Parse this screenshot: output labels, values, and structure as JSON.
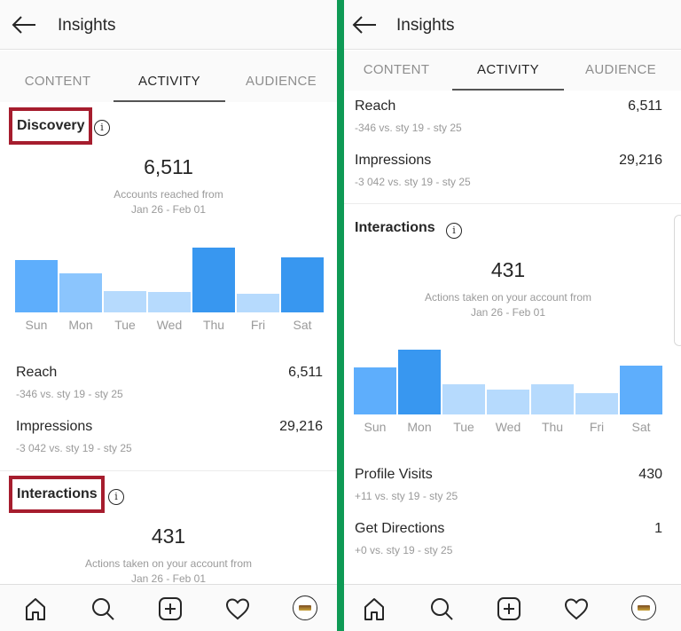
{
  "app": {
    "title": "Insights",
    "tabs": [
      "CONTENT",
      "ACTIVITY",
      "AUDIENCE"
    ],
    "active_tab": "ACTIVITY",
    "accent_colors": {
      "bar_dark": "#3897f0",
      "bar_mid": "#5eaefc",
      "bar_light_mid": "#8bc5fd",
      "bar_light": "#b6dafd",
      "highlight_box": "#a61d2e",
      "divider": "#0e9a55"
    }
  },
  "left": {
    "discovery": {
      "title": "Discovery",
      "value": "6,511",
      "caption_line1": "Accounts reached from",
      "caption_line2": "Jan 26 - Feb 01"
    },
    "metrics": [
      {
        "label": "Reach",
        "value": "6,511",
        "delta": "-346 vs. sty 19 - sty 25"
      },
      {
        "label": "Impressions",
        "value": "29,216",
        "delta": "-3 042 vs. sty 19 - sty 25"
      }
    ],
    "interactions": {
      "title": "Interactions",
      "value": "431",
      "caption_line1": "Actions taken on your account from",
      "caption_line2": "Jan 26 - Feb 01"
    }
  },
  "right": {
    "metrics_top": [
      {
        "label": "Reach",
        "value": "6,511",
        "delta": "-346 vs. sty 19 - sty 25"
      },
      {
        "label": "Impressions",
        "value": "29,216",
        "delta": "-3 042 vs. sty 19 - sty 25"
      }
    ],
    "interactions": {
      "title": "Interactions",
      "value": "431",
      "caption_line1": "Actions taken on your account from",
      "caption_line2": "Jan 26 - Feb 01"
    },
    "metrics_bottom": [
      {
        "label": "Profile Visits",
        "value": "430",
        "delta": "+11 vs. sty 19 - sty 25"
      },
      {
        "label": "Get Directions",
        "value": "1",
        "delta": "+0 vs. sty 19 - sty 25"
      }
    ]
  },
  "nav": [
    "home-icon",
    "search-icon",
    "new-post-icon",
    "activity-heart-icon",
    "profile-avatar"
  ],
  "chart_data": [
    {
      "type": "bar",
      "title": "Discovery - Accounts reached (relative daily level)",
      "categories": [
        "Sun",
        "Mon",
        "Tue",
        "Wed",
        "Thu",
        "Fri",
        "Sat"
      ],
      "values": [
        81,
        60,
        33,
        32,
        100,
        29,
        85
      ],
      "shade": [
        "mid",
        "light_mid",
        "light",
        "light",
        "dark",
        "light",
        "dark"
      ],
      "xlabel": "",
      "ylabel": "",
      "ylim": [
        0,
        100
      ],
      "grid": false
    },
    {
      "type": "bar",
      "title": "Interactions - Actions taken (relative daily level)",
      "categories": [
        "Sun",
        "Mon",
        "Tue",
        "Wed",
        "Thu",
        "Fri",
        "Sat"
      ],
      "values": [
        72,
        100,
        46,
        38,
        47,
        33,
        75
      ],
      "shade": [
        "mid",
        "dark",
        "light",
        "light",
        "light",
        "light",
        "mid"
      ],
      "xlabel": "",
      "ylabel": "",
      "ylim": [
        0,
        100
      ],
      "grid": false
    }
  ]
}
